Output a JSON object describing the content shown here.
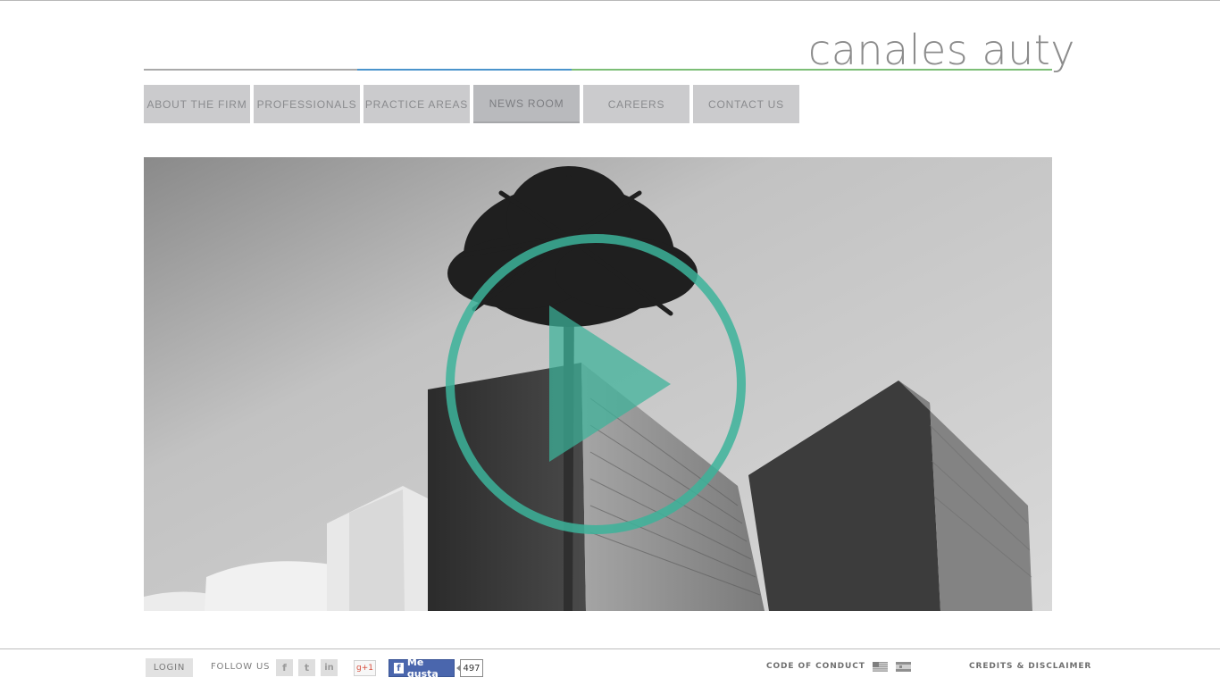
{
  "brand": {
    "logo_text": "canales auty"
  },
  "nav": {
    "items": [
      {
        "label": "ABOUT THE FIRM"
      },
      {
        "label": "PROFESSIONALS"
      },
      {
        "label": "PRACTICE AREAS"
      },
      {
        "label": "NEWS ROOM",
        "active": true
      },
      {
        "label": "CAREERS"
      },
      {
        "label": "CONTACT US"
      }
    ]
  },
  "hero": {
    "play_icon": "play-circle-icon",
    "accent_color": "#3cb39a"
  },
  "footer": {
    "login_label": "LOGIN",
    "follow_label": "FOLLOW US",
    "social": [
      {
        "icon": "facebook-icon",
        "glyph": "f"
      },
      {
        "icon": "twitter-icon",
        "glyph": "t"
      },
      {
        "icon": "linkedin-icon",
        "glyph": "in"
      }
    ],
    "gplus_label": "g+1",
    "fb_like_label": "Me gusta",
    "fb_like_count": "497",
    "code_of_conduct": "CODE OF CONDUCT",
    "credits": "CREDITS & DISCLAIMER",
    "flags": [
      "us-flag-icon",
      "spain-flag-icon"
    ]
  }
}
